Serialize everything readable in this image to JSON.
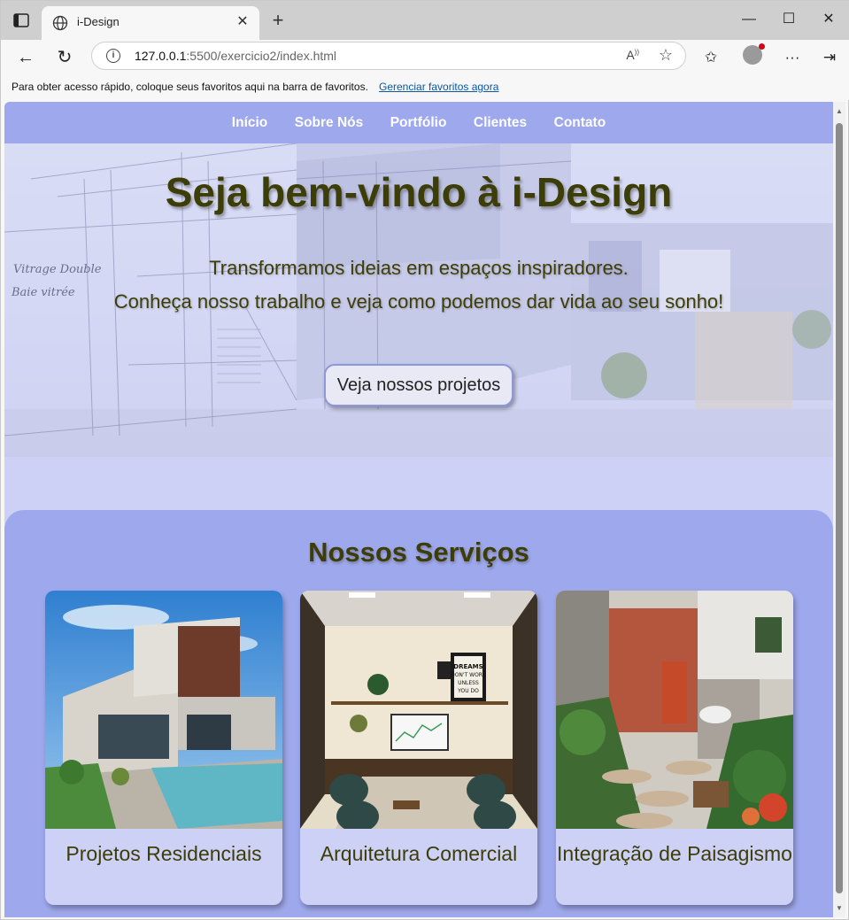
{
  "browser": {
    "tab_title": "i-Design",
    "url_host": "127.0.0.1",
    "url_rest": ":5500/exercicio2/index.html",
    "favorites_message": "Para obter acesso rápido, coloque seus favoritos aqui na barra de favoritos.",
    "favorites_link": "Gerenciar favoritos agora"
  },
  "site": {
    "nav": [
      "Início",
      "Sobre Nós",
      "Portfólio",
      "Clientes",
      "Contato"
    ],
    "hero": {
      "title": "Seja bem-vindo à i-Design",
      "line1": "Transformamos ideias em espaços inspiradores.",
      "line2": "Conheça nosso trabalho e veja como podemos dar vida ao seu sonho!",
      "cta": "Veja nossos projetos",
      "sketch_text_1": "Vitrage Double",
      "sketch_text_2": "Baie vitrée"
    },
    "services": {
      "title": "Nossos Serviços",
      "cards": [
        {
          "label": "Projetos Residenciais"
        },
        {
          "label": "Arquitetura Comercial"
        },
        {
          "label": "Integração de Paisagismo"
        }
      ],
      "poster_text": "DREAMS DON'T WORK UNLESS YOU DO"
    }
  },
  "colors": {
    "accent": "#9ea8ec",
    "text_olive": "#3d3d08",
    "page_bg": "#cdd1f6"
  }
}
